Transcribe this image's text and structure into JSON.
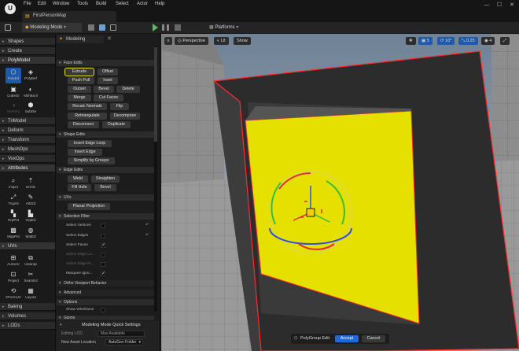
{
  "titlebar": {
    "logo": "U",
    "menu": [
      "File",
      "Edit",
      "Window",
      "Tools",
      "Build",
      "Select",
      "Actor",
      "Help"
    ],
    "map_tab": "FirstPersonMap",
    "window_controls": [
      "—",
      "☐",
      "✕"
    ]
  },
  "toolbar": {
    "mode_label": "Modeling Mode",
    "platforms_label": "Platforms"
  },
  "modes": {
    "categories_top": [
      "Shapes",
      "Create",
      "PolyModel"
    ],
    "polymodel_tools": [
      "PolyEd",
      "PolyDef",
      "CubeGr",
      "MshBool",
      "MshMrg",
      "SubDiv"
    ],
    "categories_mid": [
      "TriModel",
      "Deform",
      "Transform",
      "MeshOps",
      "VoxOps",
      "Attributes"
    ],
    "attribute_tools": [
      "Inspct",
      "Nrmls",
      "Tngnts",
      "AttrEd",
      "GrpPnt",
      "GrpEd",
      "MapPnt",
      "MatEd"
    ],
    "uvs_label": "UVs",
    "uv_tools": [
      "AutoUV",
      "Unwrap",
      "Project",
      "SeamEd",
      "XFormUV",
      "Layout"
    ],
    "categories_bottom": [
      "Baking",
      "Volumes",
      "LODs"
    ]
  },
  "panel": {
    "tab_label": "Modeling",
    "face_edits": {
      "header": "Face Edits",
      "buttons": [
        "Extrude",
        "Offset",
        "Push Pull",
        "Inset",
        "Outset",
        "Bevel",
        "Delete",
        "Merge",
        "Cut Faces",
        "Recalc Normals",
        "Flip",
        "Retriangulate",
        "Decompose",
        "Disconnect",
        "Duplicate"
      ]
    },
    "shape_edits": {
      "header": "Shape Edits",
      "buttons": [
        "Insert Edge Loop",
        "Insert Edge",
        "Simplify by Groups"
      ]
    },
    "edge_edits": {
      "header": "Edge Edits",
      "buttons": [
        "Weld",
        "Straighten",
        "Fill Hole",
        "Bevel"
      ]
    },
    "uvs": {
      "header": "UVs",
      "buttons": [
        "Planar Projection"
      ]
    },
    "selection_filter": {
      "header": "Selection Filter",
      "rows": [
        "Select Vertices",
        "Select Edges",
        "Select Faces",
        "Select Edge Lo...",
        "Select Edge Ri...",
        "Marquee Igno..."
      ]
    },
    "ortho_label": "Ortho Viewport Behavior",
    "advanced_label": "Advanced",
    "options_header": "Options",
    "show_wireframe": "Show Wireframe",
    "gizmo_header": "Gizmo"
  },
  "quick_settings": {
    "header": "Modeling Mode Quick Settings",
    "editing_lod_label": "Editing LOD",
    "editing_lod_value": "Max Available",
    "asset_location_label": "New Asset Location",
    "asset_location_value": "AutoGen Folder"
  },
  "viewport": {
    "perspective": "Perspective",
    "lit": "Lit",
    "show": "Show",
    "snap_values": [
      "5",
      "10°",
      "0.25",
      "4"
    ],
    "edit_label": "PolyGroup Edit",
    "accept": "Accept",
    "cancel": "Cancel"
  },
  "colors": {
    "accent": "#1e6ad6",
    "highlight": "#e8e020",
    "face_yellow": "#e6e000",
    "selection_red": "#ff2a2a"
  }
}
